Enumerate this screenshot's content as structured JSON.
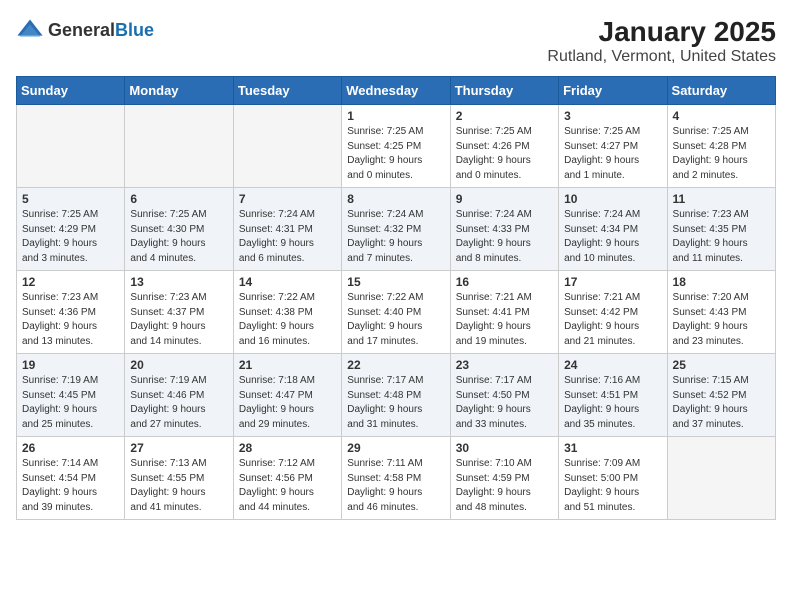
{
  "logo": {
    "text_general": "General",
    "text_blue": "Blue"
  },
  "title": "January 2025",
  "subtitle": "Rutland, Vermont, United States",
  "days_of_week": [
    "Sunday",
    "Monday",
    "Tuesday",
    "Wednesday",
    "Thursday",
    "Friday",
    "Saturday"
  ],
  "weeks": [
    [
      {
        "day": "",
        "info": ""
      },
      {
        "day": "",
        "info": ""
      },
      {
        "day": "",
        "info": ""
      },
      {
        "day": "1",
        "info": "Sunrise: 7:25 AM\nSunset: 4:25 PM\nDaylight: 9 hours\nand 0 minutes."
      },
      {
        "day": "2",
        "info": "Sunrise: 7:25 AM\nSunset: 4:26 PM\nDaylight: 9 hours\nand 0 minutes."
      },
      {
        "day": "3",
        "info": "Sunrise: 7:25 AM\nSunset: 4:27 PM\nDaylight: 9 hours\nand 1 minute."
      },
      {
        "day": "4",
        "info": "Sunrise: 7:25 AM\nSunset: 4:28 PM\nDaylight: 9 hours\nand 2 minutes."
      }
    ],
    [
      {
        "day": "5",
        "info": "Sunrise: 7:25 AM\nSunset: 4:29 PM\nDaylight: 9 hours\nand 3 minutes."
      },
      {
        "day": "6",
        "info": "Sunrise: 7:25 AM\nSunset: 4:30 PM\nDaylight: 9 hours\nand 4 minutes."
      },
      {
        "day": "7",
        "info": "Sunrise: 7:24 AM\nSunset: 4:31 PM\nDaylight: 9 hours\nand 6 minutes."
      },
      {
        "day": "8",
        "info": "Sunrise: 7:24 AM\nSunset: 4:32 PM\nDaylight: 9 hours\nand 7 minutes."
      },
      {
        "day": "9",
        "info": "Sunrise: 7:24 AM\nSunset: 4:33 PM\nDaylight: 9 hours\nand 8 minutes."
      },
      {
        "day": "10",
        "info": "Sunrise: 7:24 AM\nSunset: 4:34 PM\nDaylight: 9 hours\nand 10 minutes."
      },
      {
        "day": "11",
        "info": "Sunrise: 7:23 AM\nSunset: 4:35 PM\nDaylight: 9 hours\nand 11 minutes."
      }
    ],
    [
      {
        "day": "12",
        "info": "Sunrise: 7:23 AM\nSunset: 4:36 PM\nDaylight: 9 hours\nand 13 minutes."
      },
      {
        "day": "13",
        "info": "Sunrise: 7:23 AM\nSunset: 4:37 PM\nDaylight: 9 hours\nand 14 minutes."
      },
      {
        "day": "14",
        "info": "Sunrise: 7:22 AM\nSunset: 4:38 PM\nDaylight: 9 hours\nand 16 minutes."
      },
      {
        "day": "15",
        "info": "Sunrise: 7:22 AM\nSunset: 4:40 PM\nDaylight: 9 hours\nand 17 minutes."
      },
      {
        "day": "16",
        "info": "Sunrise: 7:21 AM\nSunset: 4:41 PM\nDaylight: 9 hours\nand 19 minutes."
      },
      {
        "day": "17",
        "info": "Sunrise: 7:21 AM\nSunset: 4:42 PM\nDaylight: 9 hours\nand 21 minutes."
      },
      {
        "day": "18",
        "info": "Sunrise: 7:20 AM\nSunset: 4:43 PM\nDaylight: 9 hours\nand 23 minutes."
      }
    ],
    [
      {
        "day": "19",
        "info": "Sunrise: 7:19 AM\nSunset: 4:45 PM\nDaylight: 9 hours\nand 25 minutes."
      },
      {
        "day": "20",
        "info": "Sunrise: 7:19 AM\nSunset: 4:46 PM\nDaylight: 9 hours\nand 27 minutes."
      },
      {
        "day": "21",
        "info": "Sunrise: 7:18 AM\nSunset: 4:47 PM\nDaylight: 9 hours\nand 29 minutes."
      },
      {
        "day": "22",
        "info": "Sunrise: 7:17 AM\nSunset: 4:48 PM\nDaylight: 9 hours\nand 31 minutes."
      },
      {
        "day": "23",
        "info": "Sunrise: 7:17 AM\nSunset: 4:50 PM\nDaylight: 9 hours\nand 33 minutes."
      },
      {
        "day": "24",
        "info": "Sunrise: 7:16 AM\nSunset: 4:51 PM\nDaylight: 9 hours\nand 35 minutes."
      },
      {
        "day": "25",
        "info": "Sunrise: 7:15 AM\nSunset: 4:52 PM\nDaylight: 9 hours\nand 37 minutes."
      }
    ],
    [
      {
        "day": "26",
        "info": "Sunrise: 7:14 AM\nSunset: 4:54 PM\nDaylight: 9 hours\nand 39 minutes."
      },
      {
        "day": "27",
        "info": "Sunrise: 7:13 AM\nSunset: 4:55 PM\nDaylight: 9 hours\nand 41 minutes."
      },
      {
        "day": "28",
        "info": "Sunrise: 7:12 AM\nSunset: 4:56 PM\nDaylight: 9 hours\nand 44 minutes."
      },
      {
        "day": "29",
        "info": "Sunrise: 7:11 AM\nSunset: 4:58 PM\nDaylight: 9 hours\nand 46 minutes."
      },
      {
        "day": "30",
        "info": "Sunrise: 7:10 AM\nSunset: 4:59 PM\nDaylight: 9 hours\nand 48 minutes."
      },
      {
        "day": "31",
        "info": "Sunrise: 7:09 AM\nSunset: 5:00 PM\nDaylight: 9 hours\nand 51 minutes."
      },
      {
        "day": "",
        "info": ""
      }
    ]
  ]
}
